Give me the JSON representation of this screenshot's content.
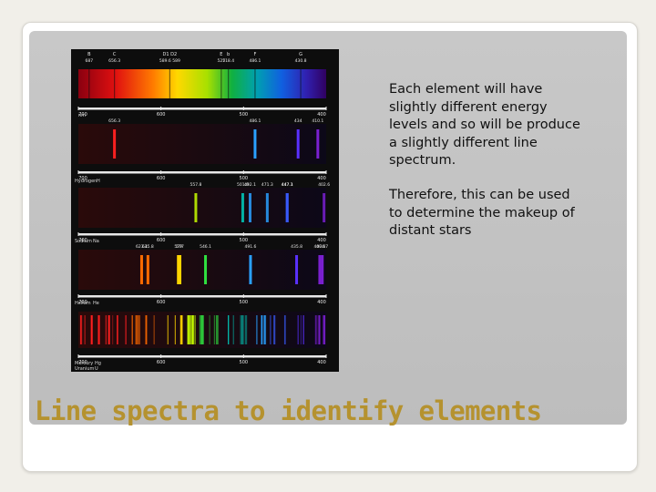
{
  "slide": {
    "title": "Line spectra to identify elements",
    "paragraphs": [
      "Each element will have slightly different energy levels and so will be produce a slightly different line spectrum.",
      "Therefore, this can be used to determine the makeup of distant stars"
    ]
  },
  "figure": {
    "continuous": {
      "letters": [
        "B",
        "C",
        "D1 D2",
        "E",
        "b",
        "F",
        "G"
      ],
      "values": [
        "687",
        "656.3",
        "589.6 589",
        "527",
        "518.4",
        "486.1",
        "430.8"
      ],
      "scale": [
        "700",
        "600",
        "500",
        "400"
      ],
      "unit": "nm"
    },
    "hydrogen": {
      "label": "Hydrogen",
      "symbol": "H",
      "lines": [
        "656.3",
        "486.1",
        "434",
        "410.1"
      ],
      "scale": [
        "700",
        "600",
        "500",
        "400"
      ]
    },
    "sodium": {
      "label": "Sodium",
      "symbol": "Na",
      "lines": [
        "557.8",
        "447.3",
        "501.0",
        "492.1",
        "471.3",
        "447.1",
        "402.6"
      ],
      "scale": [
        "700",
        "600",
        "500",
        "400"
      ]
    },
    "helium": {
      "label": "Helium",
      "symbol": "He",
      "lines": [
        "623.4",
        "615.8",
        "579",
        "577",
        "546.1",
        "491.6",
        "435.8",
        "407.8",
        "404.7"
      ],
      "scale": [
        "700",
        "600",
        "500",
        "400"
      ]
    },
    "mercury": {
      "label": "Mercury",
      "symbol": "Hg",
      "scale": [
        "700",
        "600",
        "500",
        "400"
      ]
    },
    "uranium": {
      "label": "Uranium",
      "symbol": "U",
      "scale": [
        "700",
        "600",
        "500",
        "400"
      ]
    }
  }
}
